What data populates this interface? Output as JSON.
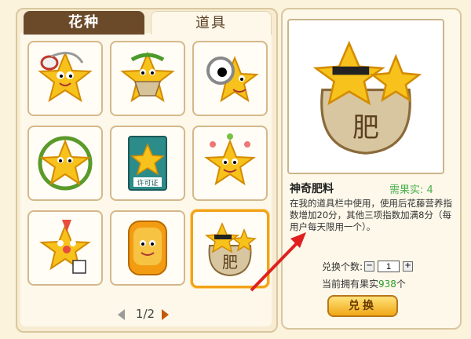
{
  "tabs": {
    "flower_seeds": "花种",
    "items": "道具"
  },
  "grid": {
    "cells": [
      {
        "name": "star-with-headphones"
      },
      {
        "name": "star-with-leaf-bag"
      },
      {
        "name": "star-with-magnifier"
      },
      {
        "name": "star-with-wreath"
      },
      {
        "name": "license-book"
      },
      {
        "name": "star-with-flowers"
      },
      {
        "name": "star-clown"
      },
      {
        "name": "star-in-jar"
      },
      {
        "name": "magic-fertilizer"
      }
    ],
    "selected_index": 8
  },
  "pager": {
    "label": "1/2"
  },
  "license_text": "许可证",
  "detail": {
    "name": "神奇肥料",
    "need_label": "需果实:",
    "need_value": "4",
    "bag_text": "肥",
    "description": "在我的道具栏中使用，使用后花藤营养指数增加20分，其他三项指数加满8分（每用户每天限用一个）。",
    "qty_label": "兑换个数:",
    "qty_value": "1",
    "owned_label": "当前拥有果实",
    "owned_value": "938",
    "owned_unit": "个",
    "exchange_label": "兑换"
  },
  "colors": {
    "accent_orange": "#f2a21b",
    "tab_brown": "#6b4a2a",
    "green_text": "#4caf50",
    "arrow_red": "#e02020"
  }
}
